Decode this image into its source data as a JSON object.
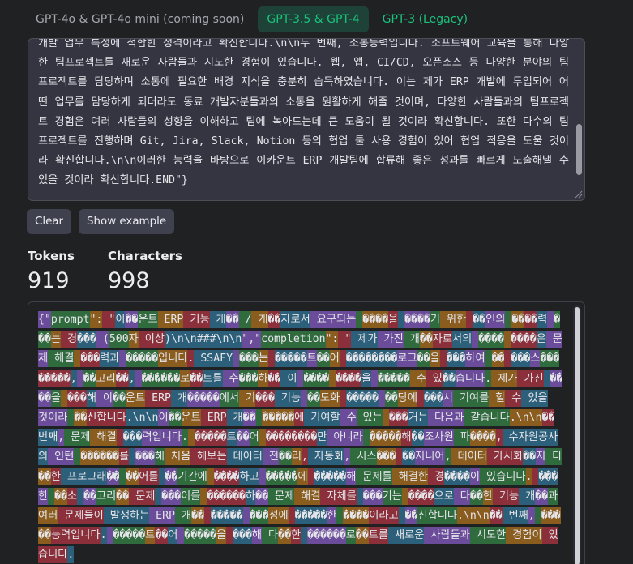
{
  "tabs": [
    {
      "label": "GPT-4o & GPT-4o mini (coming soon)",
      "state": "disabled"
    },
    {
      "label": "GPT-3.5 & GPT-4",
      "state": "active"
    },
    {
      "label": "GPT-3 (Legacy)",
      "state": "inactive"
    }
  ],
  "editor": {
    "text": "개발 업무 특성에 적합한 성격이라고 확신합니다.\\n\\n두 번째, 소통능력입니다. 소프트웨어 교육을 통해 다양한 팀프로젝트를 새로운 사람들과 시도한 경험이 있습니다. 웹, 앱, CI/CD, 오픈소스 등 다양한 분야의 팀프로젝트를 담당하며 소통에 필요한 배경 지식을 충분히 습득하였습니다. 이는 제가 ERP 개발에 투입되어 어떤 업무를 담당하게 되더라도 동료 개발자분들과의 소통을 원활하게 해줄 것이며, 다양한 사람들과의 팀프로젝트 경험은 여러 사람들의 성향을 이해하고 팀에 녹아드는데 큰 도움이 될 것이라 확신합니다. 또한 다수의 팀 프로젝트를 진행하며 Git, Jira, Slack, Notion 등의 협업 툴 사용 경험이 있어 협업 적응을 도울 것이라 확신합니다.\\n\\n이러한 능력을 바탕으로 이카운트 ERP 개발팀에 합류해 좋은 성과를 빠르게 도출해낼 수 있을 것이라 확신합니다.END\"}"
  },
  "buttons": {
    "clear": "Clear",
    "show_example": "Show example"
  },
  "stats": {
    "tokens_label": "Tokens",
    "tokens_value": "919",
    "characters_label": "Characters",
    "characters_value": "998"
  },
  "token_colors": [
    "#6b4c9a",
    "#2f6b3c",
    "#8a5c1e",
    "#8b2f3a",
    "#2b5f7a"
  ],
  "tokens": [
    "{\"",
    "prompt",
    "\":",
    " \"",
    "이",
    "��",
    "운트",
    " ERP",
    " 기능",
    " 개",
    "��",
    " /",
    " 개",
    "��",
    "자로서",
    " 요구되는",
    " ",
    "����",
    "을",
    " ",
    "����",
    "기",
    " 위한",
    " ",
    "��",
    "인의",
    " ",
    "��",
    "��",
    "력",
    " ",
    "���",
    "는",
    " 경",
    "���",
    " (",
    "500",
    "자",
    " 이상",
    ")\\n\\n###\\n\\n",
    "\",\"",
    "completion",
    "\":",
    " \"",
    " 제가",
    " 가진",
    " 개",
    "��",
    "자로",
    "서의",
    " ",
    "����",
    " ",
    "����",
    "은",
    " 문제",
    " 해결",
    " ",
    "���",
    "력과",
    " ",
    "�����",
    "입니다",
    ".",
    " SSAFY",
    " ",
    "���",
    "는",
    " ",
    "�����",
    "트",
    "��",
    "어",
    " ",
    "��������",
    "로그",
    "��",
    "을",
    " ",
    "���",
    "하여",
    " ",
    "��",
    " ",
    "���",
    "스",
    "���",
    " ",
    "�����",
    ",",
    " ",
    "��",
    "고리",
    "��",
    ",",
    " ",
    "������",
    "로",
    "��",
    "트를",
    " 수",
    "���",
    "하",
    "��",
    " 이",
    " ",
    "����",
    " ",
    "����",
    "을",
    " ",
    "�����",
    " 수",
    " 있",
    "��",
    "습니다",
    ".",
    " 제가",
    " 가진",
    " ",
    "����",
    "을",
    " ",
    "���",
    "해",
    " 이",
    "��",
    "운트",
    " ERP",
    " 개",
    "�����",
    "에서",
    " 기",
    "���",
    " 기능",
    " ",
    "��",
    "도화",
    " ",
    "�����",
    " ",
    "��",
    "당에",
    " ",
    "���",
    "시",
    " 기여를",
    " 할",
    " 수",
    " 있을",
    " 것이라",
    " ",
    "��",
    "신합니다",
    ".\\n\\n",
    "이",
    "��",
    "운트",
    " ERP",
    " 개",
    "��",
    " ",
    "�����",
    "에",
    " 기여할",
    " 수",
    " 있는",
    " ",
    "���",
    "거는",
    " 다음과",
    " 같습니다",
    ".\\n\\n",
    "��",
    " 번째",
    ",",
    " 문제",
    " 해결",
    " ",
    "���",
    "력입니다",
    ".",
    " ",
    "�����",
    "트",
    "��",
    "어",
    " ",
    "��������",
    "만",
    " 아니라",
    " ",
    "�����",
    "해",
    "��",
    "조사원",
    " 파",
    "����",
    ",",
    " 수자원공사의",
    " 인턴",
    " ",
    "������",
    "를",
    " ",
    "���",
    "해",
    " 처음",
    " 해보는",
    " 데이터",
    " 전",
    "��",
    "리",
    ",",
    " 자동화",
    ",",
    " 시스",
    "���",
    " ",
    "��",
    "지니어",
    ",",
    " 데이터",
    " 가시화",
    "��",
    "지",
    " 다",
    "��",
    "한",
    " 프로그래",
    "��",
    " ",
    "��",
    "어를",
    " ",
    "��",
    "기간에",
    " ",
    "����",
    "하고",
    " ",
    "�����",
    "에",
    " ",
    "�����",
    "해",
    " 문제를",
    " 해결한",
    " 경",
    "����",
    "이",
    " 있습니다",
    ".",
    " ",
    "���",
    "한",
    " ",
    "��",
    "소",
    " ",
    "��",
    "고리",
    "��",
    " 문제",
    " ",
    "���",
    "이를",
    " ",
    "������",
    "하",
    "��",
    " 문제",
    " 해결",
    " 자체를",
    " ",
    "���",
    "기는",
    " ",
    "����",
    "으로",
    " 다",
    "��",
    "한",
    " 기능",
    " 개",
    "��",
    "과",
    " 여러",
    " 문제들이",
    " 발생하는",
    " ERP",
    " 개",
    "��",
    " ",
    "�����",
    " ",
    "���",
    "성에",
    " ",
    "�����",
    "한",
    " ",
    "����",
    "이라고",
    " ",
    "��",
    "신합니다",
    ".\\n\\n",
    "��",
    " 번째",
    ",",
    " ",
    "�����",
    "능력입니다",
    ".",
    " ",
    "�����",
    "트",
    "��",
    "어",
    " ",
    "�����",
    "을",
    " ",
    "���",
    "해",
    " 다",
    "��",
    "한",
    " ",
    "������",
    "로",
    "��",
    "트를",
    " 새로운",
    " 사람들과",
    " 시도한",
    " 경험이",
    " 있습니다",
    "."
  ]
}
